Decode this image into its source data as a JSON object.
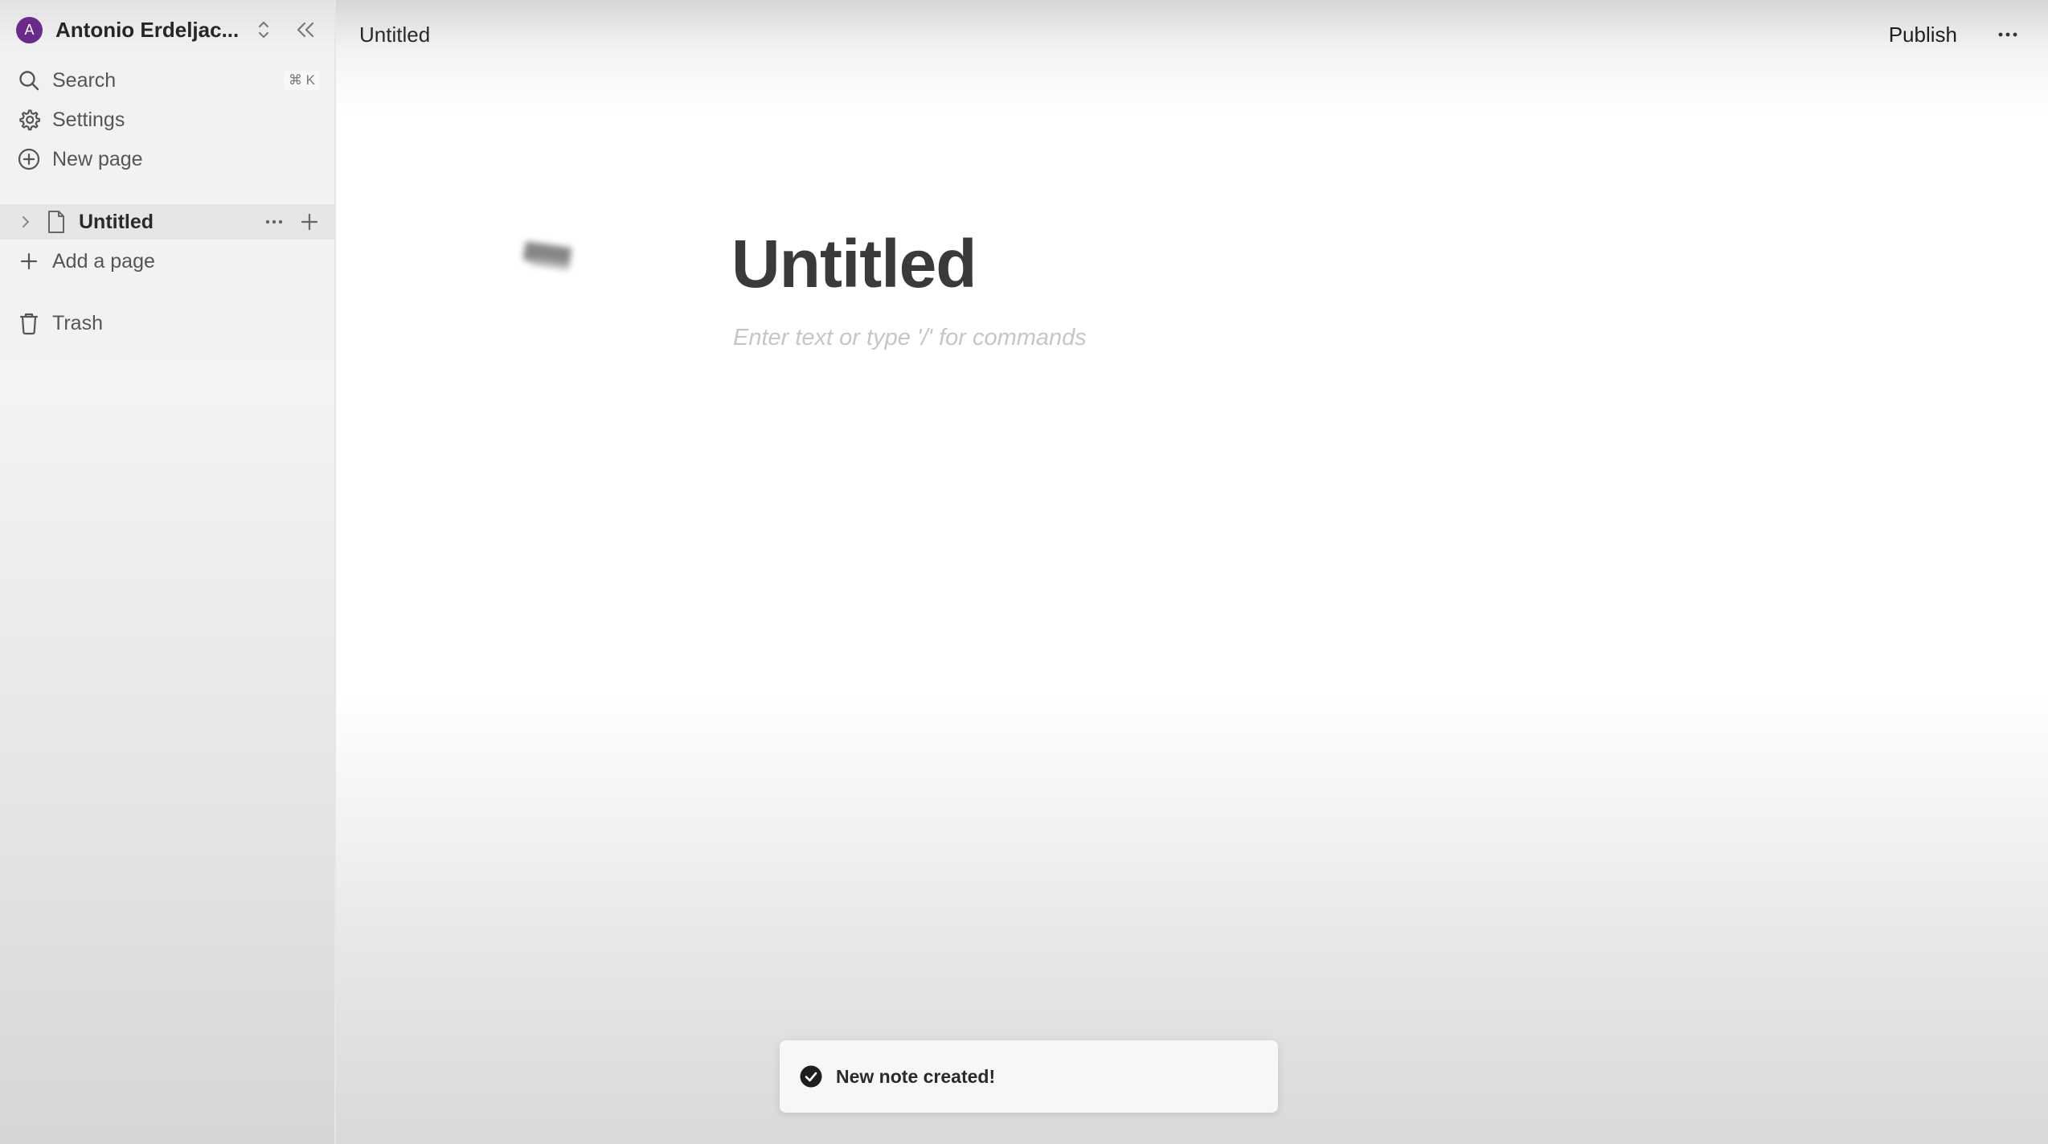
{
  "sidebar": {
    "user": {
      "avatar_letter": "A",
      "name": "Antonio Erdeljac...",
      "avatar_color": "#6a2a8c"
    },
    "nav": {
      "search_label": "Search",
      "search_shortcut": "⌘ K",
      "settings_label": "Settings",
      "new_page_label": "New page"
    },
    "pages": [
      {
        "title": "Untitled"
      }
    ],
    "add_page_label": "Add a page",
    "trash_label": "Trash"
  },
  "topbar": {
    "title": "Untitled",
    "publish_label": "Publish"
  },
  "editor": {
    "title": "Untitled",
    "placeholder": "Enter text or type '/' for commands"
  },
  "toast": {
    "message": "New note created!"
  },
  "icons": {
    "search": "search-icon",
    "settings": "gear-icon",
    "new_page": "plus-circle-icon",
    "add_page": "plus-icon",
    "trash": "trash-icon",
    "page": "document-icon",
    "chevron": "chevron-right-icon",
    "collapse": "double-chevron-left-icon",
    "switch": "chevron-up-down-icon",
    "more": "more-horizontal-icon",
    "toast": "check-circle-icon"
  }
}
